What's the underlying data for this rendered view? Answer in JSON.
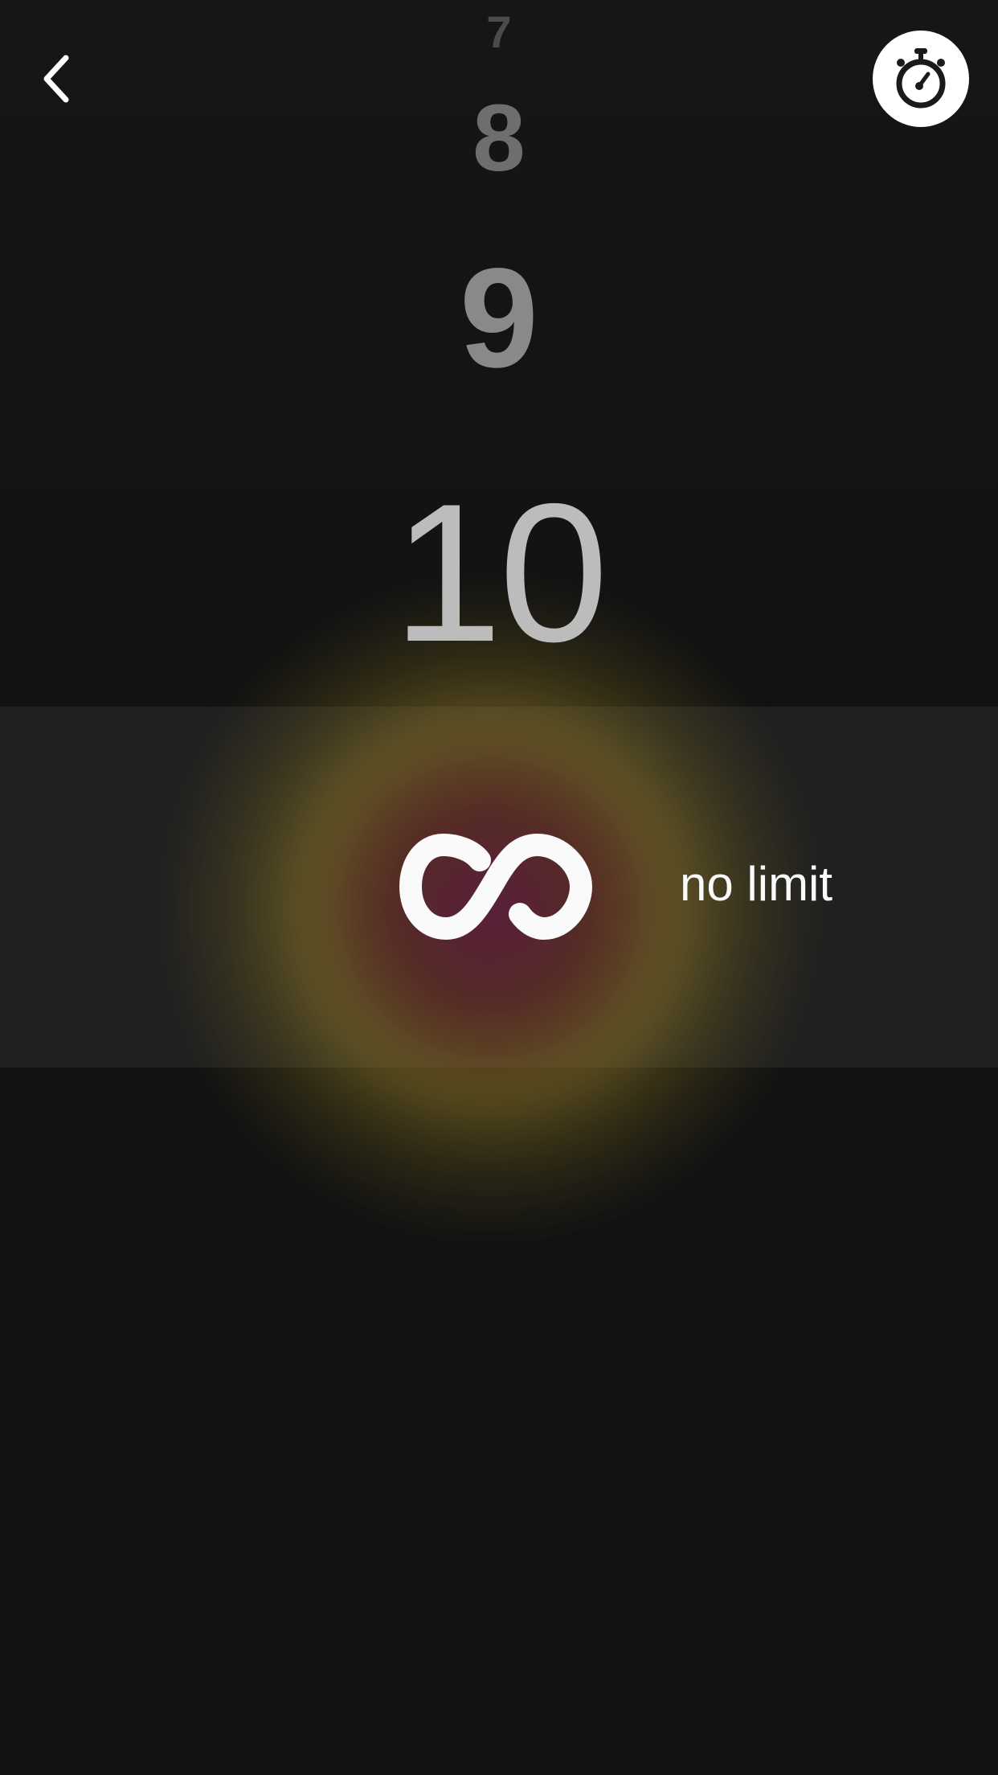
{
  "picker": {
    "values": [
      "7",
      "8",
      "9",
      "10"
    ]
  },
  "selected_option": {
    "label": "no limit",
    "icon": "infinity-icon"
  },
  "header": {
    "back_icon": "chevron-left-icon",
    "timer_icon": "stopwatch-icon"
  },
  "colors": {
    "background": "#131313",
    "band": "#202020",
    "text": "#fafafa"
  }
}
